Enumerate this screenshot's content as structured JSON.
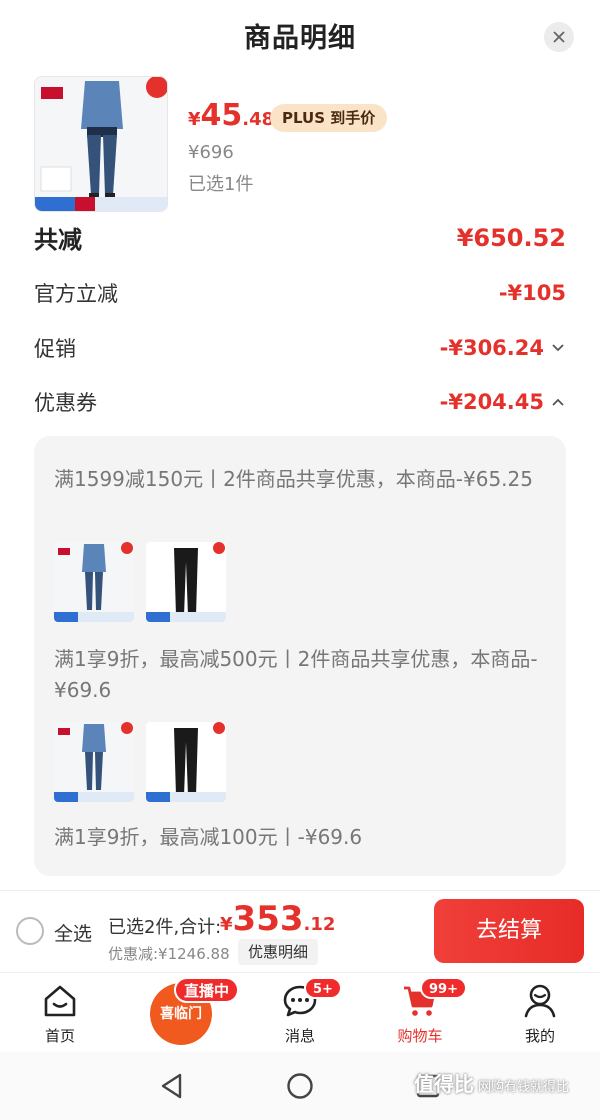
{
  "sheet": {
    "title": "商品明细"
  },
  "product": {
    "brand_logo": "Levi's",
    "price_currency": "¥",
    "price_int": "45",
    "price_dec": ".48",
    "plus_tag": "PLUS 到手价",
    "original_price": "¥696",
    "selected": "已选1件"
  },
  "summary": {
    "total_label": "共减",
    "total_value": "¥650.52",
    "rows": [
      {
        "label": "官方立减",
        "value": "-¥105"
      },
      {
        "label": "促销",
        "value": "-¥306.24"
      },
      {
        "label": "优惠券",
        "value": "-¥204.45"
      }
    ]
  },
  "coupons": [
    {
      "desc": "满1599减150元丨2件商品共享优惠，本商品-¥65.25"
    },
    {
      "desc": "满1享9折，最高减500元丨2件商品共享优惠，本商品-¥69.6"
    },
    {
      "desc": "满1享9折，最高减100元丨-¥69.6"
    }
  ],
  "checkout": {
    "select_all": "全选",
    "selected_info": "已选2件,合计:",
    "total_currency": "¥",
    "total_int": "353",
    "total_dec": ".12",
    "discount_line": "优惠减:¥1246.88",
    "detail_chip": "优惠明细",
    "button": "去结算"
  },
  "tabbar": {
    "home": "首页",
    "live_badge": "直播中",
    "live_circle_text": "喜临门",
    "messages": "消息",
    "messages_badge": "5+",
    "cart": "购物车",
    "cart_badge": "99+",
    "me": "我的"
  },
  "watermark": {
    "main": "值得比",
    "sub": "网购有钱就得比"
  },
  "colors": {
    "accent": "#e4312b",
    "plus_bg": "#fbe3c8",
    "live_orange": "#f15a1e"
  }
}
